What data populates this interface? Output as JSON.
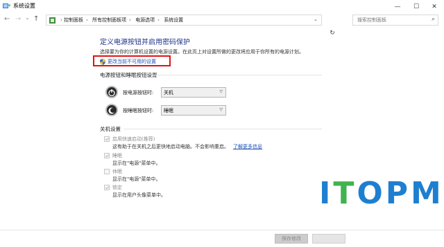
{
  "window": {
    "title": "系统设置"
  },
  "nav": {
    "back": "←",
    "forward": "→",
    "recent": "⌄",
    "up": "↑",
    "breadcrumbs": [
      "控制面板",
      "所有控制面板项",
      "电源选项",
      "系统设置"
    ],
    "search_placeholder": "搜索控制面板"
  },
  "page": {
    "heading": "定义电源按钮并启用密码保护",
    "description": "选择要为你的计算机设置的电源设置。在此页上对设置所做的更改将应用于你所有的电源计划。",
    "change_link": "更改当前不可用的设置"
  },
  "power_buttons": {
    "section_title": "电源按钮和睡眠按钮设置",
    "power_label": "按电源按钮时:",
    "power_value": "关机",
    "sleep_label": "按睡眠按钮时:",
    "sleep_value": "睡眠"
  },
  "shutdown": {
    "section_title": "关机设置",
    "options": [
      {
        "label": "启用快速启动(推荐)",
        "desc": "这有助于在关机之后更快地启动电脑。不会影响重启。",
        "link": "了解更多信息",
        "checked": true
      },
      {
        "label": "睡眠",
        "desc": "显示在\"电源\"菜单中。",
        "checked": true
      },
      {
        "label": "休眠",
        "desc": "显示在\"电源\"菜单中。",
        "checked": false
      },
      {
        "label": "锁定",
        "desc": "显示在用户头像菜单中。",
        "checked": true
      }
    ]
  },
  "footer": {
    "save": "保存修改",
    "cancel": ""
  },
  "watermark": "ITOPM",
  "colors": {
    "heading": "#1e3287",
    "link": "#1a50b8",
    "highlight": "#e01212",
    "watermark_blue": "#1e7fd0",
    "watermark_green": "#3fb34f"
  }
}
